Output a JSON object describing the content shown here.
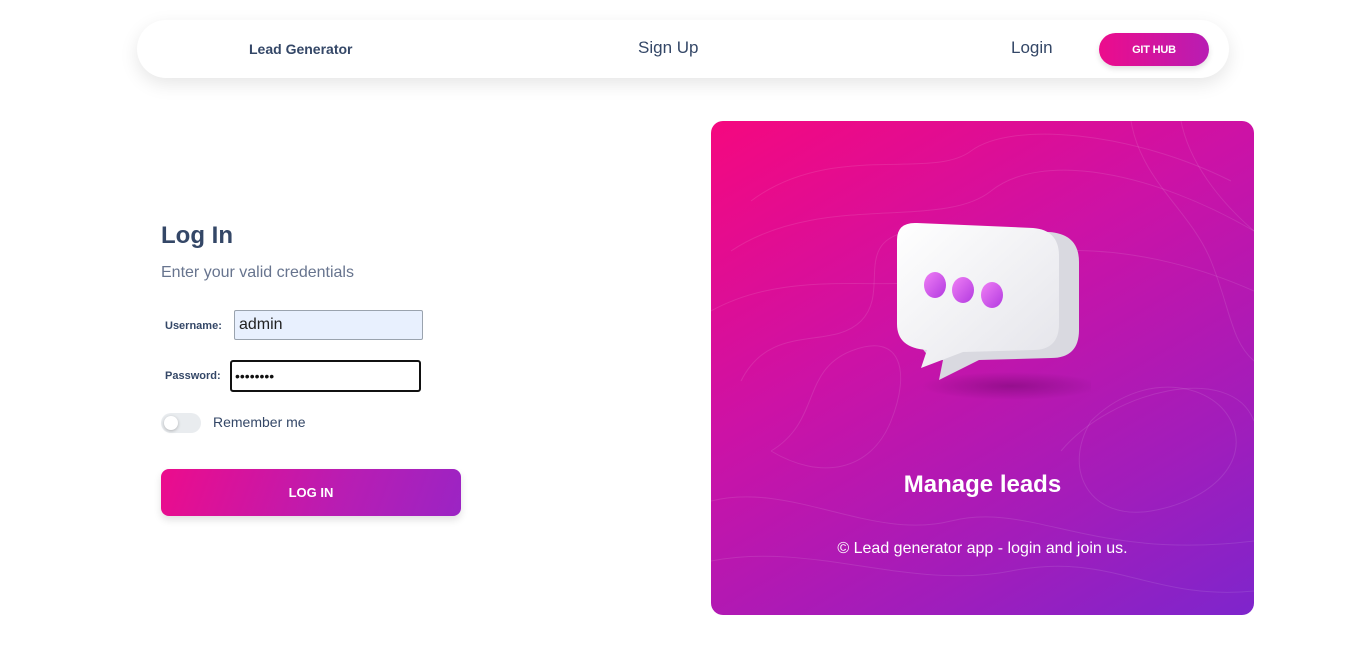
{
  "navbar": {
    "brand": "Lead Generator",
    "signup_label": "Sign Up",
    "login_label": "Login",
    "github_label": "GIT HUB"
  },
  "login": {
    "title": "Log In",
    "subtitle": "Enter your valid credentials",
    "username_label": "Username:",
    "username_value": "admin",
    "password_label": "Password:",
    "password_value": "••••••••",
    "remember_label": "Remember me",
    "remember_checked": false,
    "submit_label": "LOG IN"
  },
  "panel": {
    "heading": "Manage leads",
    "note": "© Lead generator app - login and join us.",
    "illustration_icon": "chat-bubble-icon"
  },
  "colors": {
    "accent_start": "#ec0c8c",
    "accent_end": "#b81db3",
    "panel_end": "#7e25cc",
    "text_primary": "#344767",
    "text_secondary": "#67748e"
  }
}
